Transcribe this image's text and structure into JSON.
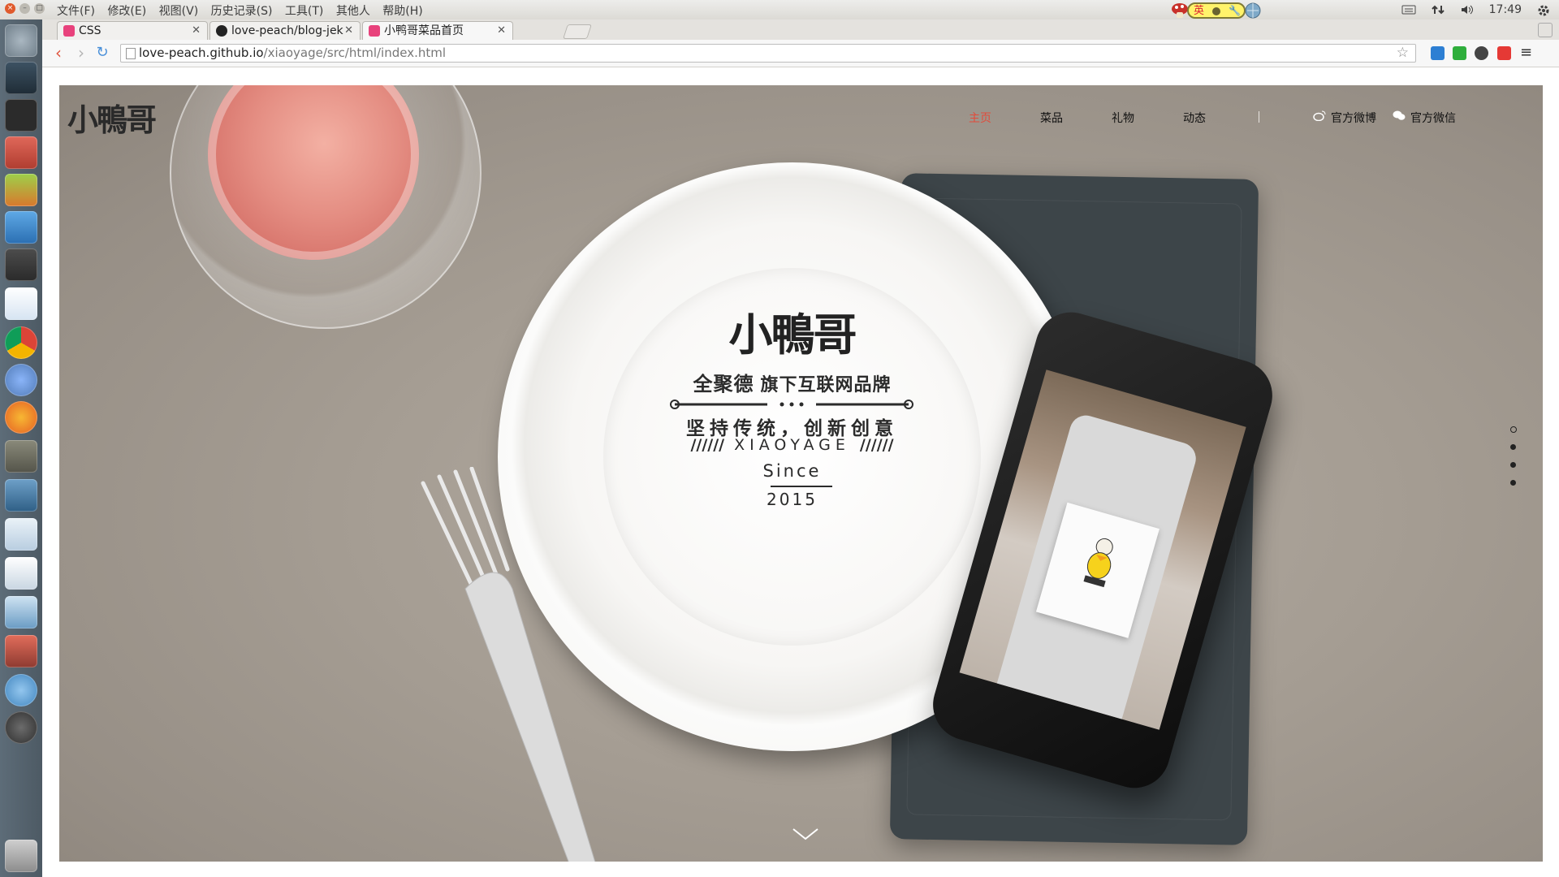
{
  "system_bar": {
    "menus": [
      "文件(F)",
      "修改(E)",
      "视图(V)",
      "历史记录(S)",
      "工具(T)",
      "其他人",
      "帮助(H)"
    ],
    "ime_label": "英",
    "clock": "17:49"
  },
  "launcher": {
    "apps": [
      "dash-home",
      "inkscape-pen",
      "terminal",
      "files",
      "gedit",
      "wps-writer",
      "sublime-text",
      "code-editor",
      "chrome",
      "chromium",
      "firefox",
      "gimp",
      "system-monitor",
      "mysql-workbench",
      "document-viewer",
      "disk-utility",
      "system-settings",
      "ubuntu-one",
      "software-updater",
      "trash"
    ]
  },
  "browser": {
    "tabs": [
      {
        "title": "CSS",
        "favicon_color": "#e8427c"
      },
      {
        "title": "love-peach/blog-jek",
        "favicon_color": "#222222"
      },
      {
        "title": "小鸭哥菜品首页",
        "favicon_color": "#e8427c"
      }
    ],
    "url_host": "love-peach.github.io",
    "url_path": "/xiaoyage/src/html/index.html"
  },
  "site": {
    "logo_text": "小鴨哥",
    "nav": [
      {
        "label": "主页",
        "active": true
      },
      {
        "label": "菜品",
        "active": false
      },
      {
        "label": "礼物",
        "active": false
      },
      {
        "label": "动态",
        "active": false
      }
    ],
    "social": [
      {
        "label": "官方微博",
        "icon": "weibo-icon"
      },
      {
        "label": "官方微信",
        "icon": "wechat-icon"
      }
    ],
    "hero": {
      "plate_logo": "小鴨哥",
      "parent_brand": "全聚德",
      "tagline_1": "旗下互联网品牌",
      "tagline_2": "坚持传统，创新创意",
      "hatch": "//////",
      "english_name": "XIAOYAGE",
      "since_label": "Since",
      "since_year": "2015"
    },
    "pager": {
      "count": 4,
      "active_index": 0
    },
    "accent_color": "#e24b3b"
  }
}
